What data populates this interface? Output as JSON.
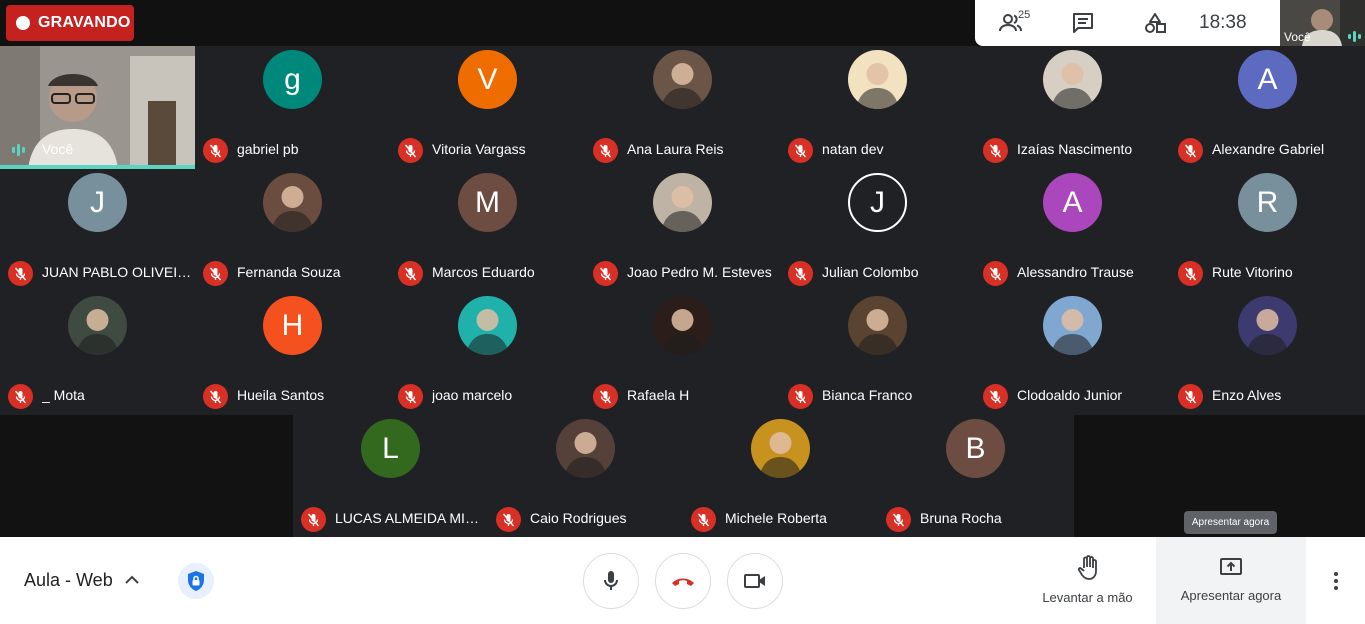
{
  "recording": {
    "label": "GRAVANDO"
  },
  "topbar": {
    "participants_count": "25",
    "time": "18:38",
    "self_label": "Você"
  },
  "self_tile": {
    "label": "Você"
  },
  "participants": [
    {
      "name": "gabriel pb",
      "initial": "g",
      "color": "#00897b"
    },
    {
      "name": "Vitoria Vargass",
      "initial": "V",
      "color": "#ef6c00"
    },
    {
      "name": "Ana Laura Reis",
      "initial": "",
      "color": "#6b5546"
    },
    {
      "name": "natan dev",
      "initial": "",
      "color": "#f3e2c0"
    },
    {
      "name": "Izaías Nascimento",
      "initial": "",
      "color": "#d7cfc4"
    },
    {
      "name": "Alexandre Gabriel",
      "initial": "A",
      "color": "#5c6bc0"
    },
    {
      "name": "JUAN PABLO OLIVEIRA",
      "initial": "J",
      "color": "#78909c"
    },
    {
      "name": "Fernanda Souza",
      "initial": "",
      "color": "#6b4d3f"
    },
    {
      "name": "Marcos Eduardo",
      "initial": "M",
      "color": "#6d4c41"
    },
    {
      "name": "Joao Pedro M. Esteves",
      "initial": "",
      "color": "#bfb3a5"
    },
    {
      "name": "Julian Colombo",
      "initial": "J",
      "color": "outline"
    },
    {
      "name": "Alessandro Trause",
      "initial": "A",
      "color": "#ab47bc"
    },
    {
      "name": "Rute Vitorino",
      "initial": "R",
      "color": "#78909c"
    },
    {
      "name": "_ Mota",
      "initial": "",
      "color": "#3f4a40"
    },
    {
      "name": "Hueila Santos",
      "initial": "H",
      "color": "#f4511e"
    },
    {
      "name": "joao marcelo",
      "initial": "",
      "color": "#20b2aa"
    },
    {
      "name": "Rafaela H",
      "initial": "",
      "color": "#2b1d1a"
    },
    {
      "name": "Bianca Franco",
      "initial": "",
      "color": "#5a4330"
    },
    {
      "name": "Clodoaldo Junior",
      "initial": "",
      "color": "#7fa7cf"
    },
    {
      "name": "Enzo Alves",
      "initial": "",
      "color": "#3c3a6e"
    },
    {
      "name": "LUCAS ALMEIDA MIOLA",
      "initial": "L",
      "color": "#33691e"
    },
    {
      "name": "Caio Rodrigues",
      "initial": "",
      "color": "#55413a"
    },
    {
      "name": "Michele Roberta",
      "initial": "",
      "color": "#c8921e"
    },
    {
      "name": "Bruna Rocha",
      "initial": "B",
      "color": "#6d4c41"
    }
  ],
  "bottombar": {
    "meeting_title": "Aula - Web",
    "raise_hand_label": "Levantar a mão",
    "present_label": "Apresentar agora",
    "present_tooltip": "Apresentar agora"
  },
  "colors": {
    "recording": "#c5221f",
    "mic_off": "#d93025",
    "accent": "#5bd5c0"
  }
}
